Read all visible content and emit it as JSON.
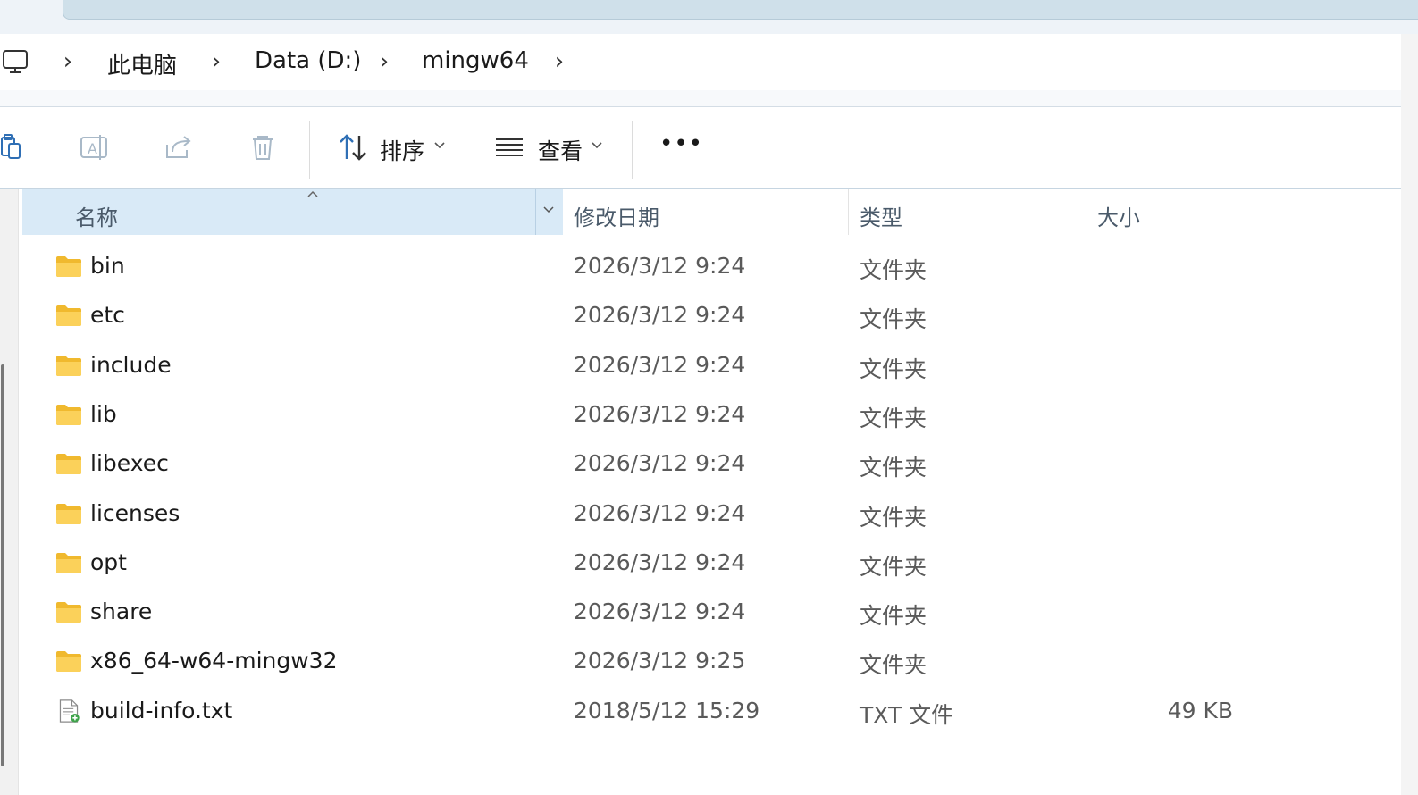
{
  "breadcrumb": {
    "items": [
      "此电脑",
      "Data (D:)",
      "mingw64"
    ]
  },
  "toolbar": {
    "sort_label": "排序",
    "view_label": "查看",
    "more_label": "•••"
  },
  "columns": {
    "name": "名称",
    "modified": "修改日期",
    "type": "类型",
    "size": "大小"
  },
  "files": [
    {
      "name": "bin",
      "modified": "2026/3/12 9:24",
      "type": "文件夹",
      "size": "",
      "icon": "folder-icon"
    },
    {
      "name": "etc",
      "modified": "2026/3/12 9:24",
      "type": "文件夹",
      "size": "",
      "icon": "folder-icon"
    },
    {
      "name": "include",
      "modified": "2026/3/12 9:24",
      "type": "文件夹",
      "size": "",
      "icon": "folder-icon"
    },
    {
      "name": "lib",
      "modified": "2026/3/12 9:24",
      "type": "文件夹",
      "size": "",
      "icon": "folder-icon"
    },
    {
      "name": "libexec",
      "modified": "2026/3/12 9:24",
      "type": "文件夹",
      "size": "",
      "icon": "folder-icon"
    },
    {
      "name": "licenses",
      "modified": "2026/3/12 9:24",
      "type": "文件夹",
      "size": "",
      "icon": "folder-icon"
    },
    {
      "name": "opt",
      "modified": "2026/3/12 9:24",
      "type": "文件夹",
      "size": "",
      "icon": "folder-icon"
    },
    {
      "name": "share",
      "modified": "2026/3/12 9:24",
      "type": "文件夹",
      "size": "",
      "icon": "folder-icon"
    },
    {
      "name": "x86_64-w64-mingw32",
      "modified": "2026/3/12 9:25",
      "type": "文件夹",
      "size": "",
      "icon": "folder-icon"
    },
    {
      "name": "build-info.txt",
      "modified": "2018/5/12 15:29",
      "type": "TXT 文件",
      "size": "49 KB",
      "icon": "text-file-icon"
    }
  ],
  "colors": {
    "accent_header": "#d9eaf7",
    "folder": "#f4c542",
    "address_bg": "#f7f9fb"
  }
}
